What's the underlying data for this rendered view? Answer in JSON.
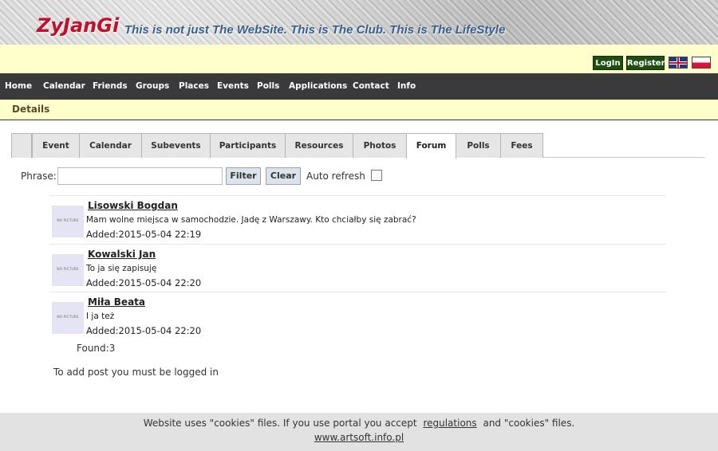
{
  "header": {
    "logo": "ZyJanGi",
    "tagline": "This is not just The WebSite. This is The Club. This is The LifeStyle"
  },
  "account": {
    "login_label": "LogIn",
    "register_label": "Register",
    "flags": [
      "english-flag-icon",
      "polish-flag-icon"
    ]
  },
  "nav": {
    "items": [
      "Home",
      "Calendar",
      "Friends",
      "Groups",
      "Places",
      "Events",
      "Polls",
      "Applications",
      "Contact",
      "Info"
    ]
  },
  "section": {
    "title": "Details"
  },
  "tabs": {
    "items": [
      "Event",
      "Calendar",
      "Subevents",
      "Participants",
      "Resources",
      "Photos",
      "Forum",
      "Polls",
      "Fees"
    ],
    "active": "Forum"
  },
  "filter": {
    "phrase_label": "Phrase:",
    "phrase_value": "",
    "filter_label": "Filter",
    "clear_label": "Clear",
    "auto_refresh_label": "Auto refresh",
    "auto_refresh_checked": false
  },
  "posts": [
    {
      "avatar_text": "NO PICTURE",
      "author": "Lisowski Bogdan",
      "text": "Mam wolne miejsca w samochodzie. Jadę z Warszawy. Kto chciałby się zabrać?",
      "added": "Added:2015-05-04 22:19"
    },
    {
      "avatar_text": "NO PICTURE",
      "author": "Kowalski Jan",
      "text": "To ja się zapisuję",
      "added": "Added:2015-05-04 22:20"
    },
    {
      "avatar_text": "NO PICTURE",
      "author": "Miła Beata",
      "text": "I ja też",
      "added": "Added:2015-05-04 22:20"
    }
  ],
  "found": "Found:3",
  "login_notice": "To add post you must be logged in",
  "cookies": {
    "text_before": "Website uses \"cookies\" files. If you use portal you accept",
    "link": "regulations",
    "text_after": "and \"cookies\" files.",
    "site": "www.artsoft.info.pl"
  },
  "colors": {
    "logo": "#c0102a",
    "tagline": "#3a5f8a",
    "account_bar": "#ffffcc",
    "nav_bg": "#3a3a3a",
    "login_button": "#1f4e10",
    "cookie_bar": "#e2e2e2"
  }
}
